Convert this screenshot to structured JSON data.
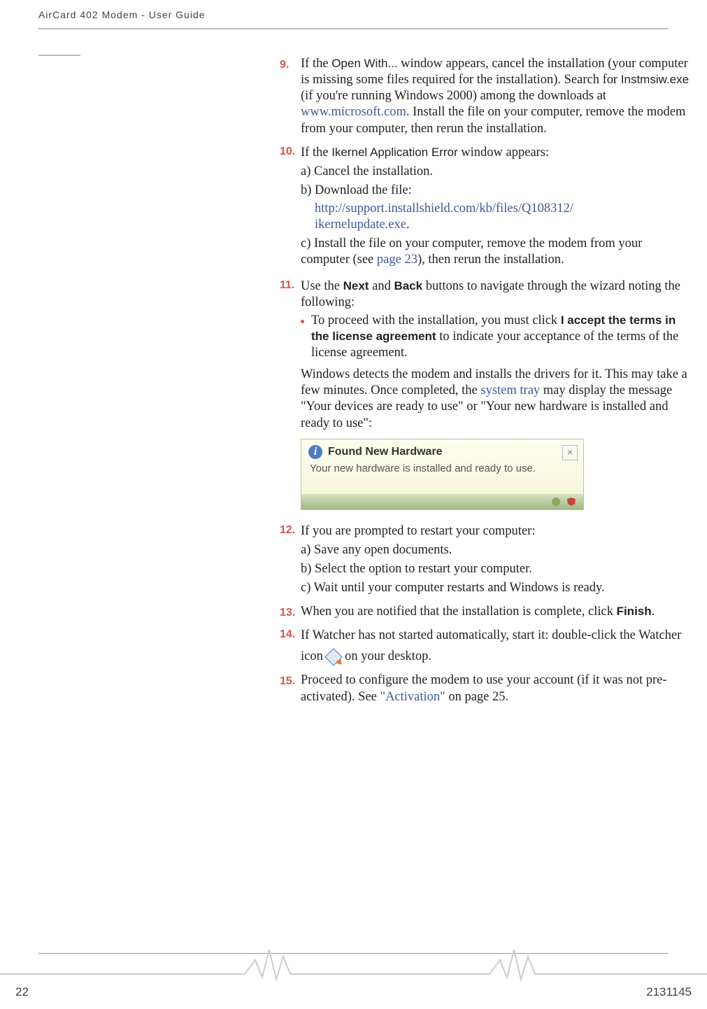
{
  "header": "AirCard 402 Modem - User Guide",
  "steps": {
    "s9": {
      "num": "9.",
      "pre": "If the ",
      "openWith": "Open With...",
      "post1": " window appears, cancel the installation (your computer is missing some files required for the installation). Search for ",
      "inst": "Instmsiw.exe",
      "post2": " (if you're running Windows 2000) among the downloads at ",
      "link": "www.microsoft.com",
      "post3": ". Install the file on your computer, remove the modem from your computer, then rerun the installation."
    },
    "s10": {
      "num": "10.",
      "pre": "If the ",
      "ikernel": "Ikernel Application Error",
      "post": " window appears:",
      "a": "a) Cancel the installation.",
      "b": "b) Download the file:",
      "blink1": "http://support.installshield.com/kb/files/Q108312/",
      "blink2": "ikernelupdate.exe",
      "bdot": ".",
      "c_pre": "c) Install the file on your computer, remove the modem from your computer (see ",
      "c_link": "page 23",
      "c_post": "), then rerun the installation."
    },
    "s11": {
      "num": "11.",
      "pre": "Use the ",
      "next": "Next",
      "mid": " and ",
      "back": "Back",
      "post": " buttons to navigate through the wizard noting the following:",
      "bullet_pre": "To proceed with the installation, you must click ",
      "accept": "I accept the terms in the license agreement",
      "bullet_post": " to indicate your acceptance of the terms of the license agreement.",
      "para_pre": "Windows detects the modem and installs the drivers for it. This may take a few minutes. Once completed, the ",
      "systray": "system tray",
      "para_post": " may display the message \"Your devices are ready to use\" or \"Your new hardware is installed and ready to use\":"
    },
    "balloon": {
      "title": "Found New Hardware",
      "body": "Your new hardware is installed and ready to use."
    },
    "s12": {
      "num": "12.",
      "line": "If you are prompted to restart your computer:",
      "a": "a) Save any open documents.",
      "b": "b) Select the option to restart your computer.",
      "c": "c) Wait until your computer restarts and Windows is ready."
    },
    "s13": {
      "num": "13.",
      "pre": "When you are notified that the installation is complete, click ",
      "finish": "Finish",
      "post": "."
    },
    "s14": {
      "num": "14.",
      "pre": "If Watcher has not started automatically, start it: double-click the Watcher icon ",
      "post": " on your desktop."
    },
    "s15": {
      "num": "15.",
      "pre": "Proceed to configure the modem to use your account (if it was not pre-activated). See ",
      "link": "\"Activation\"",
      "post": " on page 25."
    }
  },
  "footer": {
    "page": "22",
    "docid": "2131145"
  }
}
